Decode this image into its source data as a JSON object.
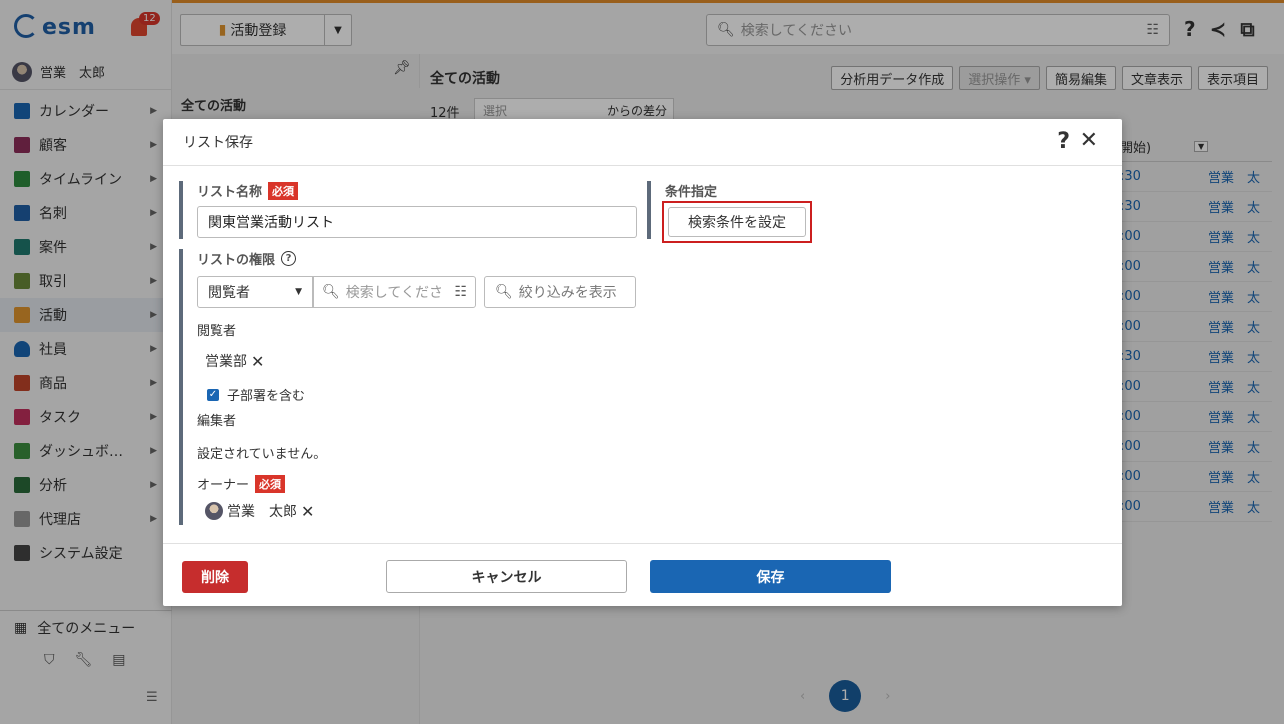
{
  "app": {
    "logo": "esm",
    "notification_count": "12"
  },
  "user": {
    "name": "営業　太郎"
  },
  "sidebar": {
    "items": [
      {
        "label": "カレンダー",
        "icon": "calendar-icon",
        "color": "#1a66b3"
      },
      {
        "label": "顧客",
        "icon": "building-icon",
        "color": "#8e2f5a"
      },
      {
        "label": "タイムライン",
        "icon": "timeline-icon",
        "color": "#2e8b3e"
      },
      {
        "label": "名刺",
        "icon": "card-icon",
        "color": "#1f5fa6"
      },
      {
        "label": "案件",
        "icon": "folder-icon",
        "color": "#1f7a6f"
      },
      {
        "label": "取引",
        "icon": "deal-icon",
        "color": "#6a8a3a"
      },
      {
        "label": "活動",
        "icon": "clipboard-icon",
        "color": "#e0962f"
      },
      {
        "label": "社員",
        "icon": "person-icon",
        "color": "#1a66b3"
      },
      {
        "label": "商品",
        "icon": "box-icon",
        "color": "#c0442a"
      },
      {
        "label": "タスク",
        "icon": "check-icon",
        "color": "#c2305e"
      },
      {
        "label": "ダッシュボ…",
        "icon": "dashboard-icon",
        "color": "#3b8e3e"
      },
      {
        "label": "分析",
        "icon": "chart-icon",
        "color": "#2a6a3a"
      },
      {
        "label": "代理店",
        "icon": "document-icon",
        "color": "#999999"
      },
      {
        "label": "システム設定",
        "icon": "gear-icon",
        "color": "#444444"
      }
    ],
    "all_menu": "全てのメニュー"
  },
  "topbar": {
    "register_label": "活動登録",
    "search_placeholder": "検索してください"
  },
  "listpanel": {
    "header": "全ての活動"
  },
  "content": {
    "title": "全ての活動",
    "buttons": [
      "分析用データ作成",
      "選択操作 ▾",
      "簡易編集",
      "文章表示",
      "表示項目"
    ],
    "count": "12件",
    "select_placeholder": "選択",
    "select_suffix": "からの差分",
    "column_header": "開始)",
    "rows": [
      {
        "time": ":30",
        "person": "営業　太"
      },
      {
        "time": ":30",
        "person": "営業　太"
      },
      {
        "time": ":00",
        "person": "営業　太"
      },
      {
        "time": ":00",
        "person": "営業　太"
      },
      {
        "time": ":00",
        "person": "営業　太"
      },
      {
        "time": ":00",
        "person": "営業　太"
      },
      {
        "time": ":30",
        "person": "営業　太"
      },
      {
        "time": ":00",
        "person": "営業　太"
      },
      {
        "time": ":00",
        "person": "営業　太"
      },
      {
        "time": ":00",
        "person": "営業　太"
      },
      {
        "time": ":00",
        "person": "営業　太"
      },
      {
        "time": ":00",
        "person": "営業　太"
      }
    ],
    "page": "1"
  },
  "modal": {
    "title": "リスト保存",
    "name_label": "リスト名称",
    "required": "必須",
    "name_value": "関東営業活動リスト",
    "cond_label": "条件指定",
    "cond_button": "検索条件を設定",
    "perm_label": "リストの権限",
    "perm_select": "閲覧者",
    "perm_search_placeholder": "検索してくださ",
    "perm_filter": "絞り込みを表示",
    "viewer_label": "閲覧者",
    "viewer_item": "営業部",
    "include_sub": "子部署を含む",
    "editor_label": "編集者",
    "editor_none": "設定されていません。",
    "owner_label": "オーナー",
    "owner_name": "営業　太郎",
    "delete": "削除",
    "cancel": "キャンセル",
    "save": "保存"
  }
}
